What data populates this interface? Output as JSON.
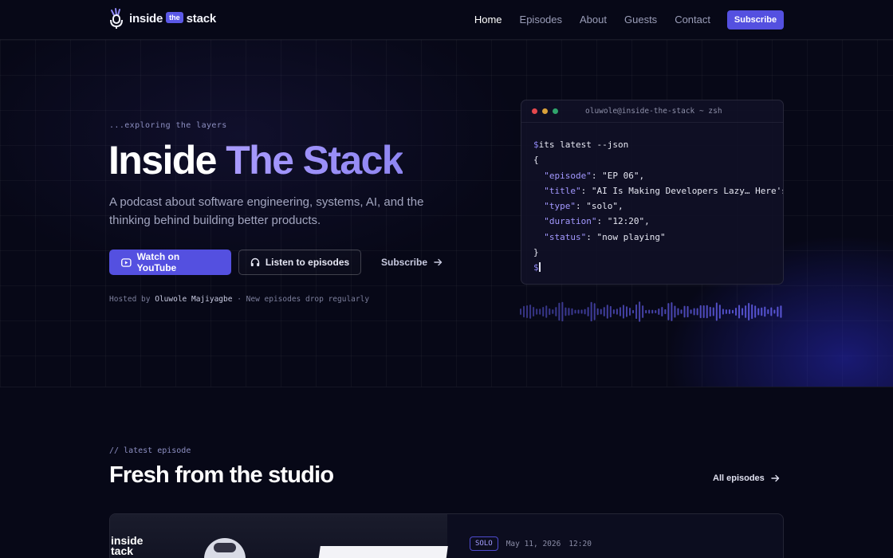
{
  "brand": {
    "word1": "inside",
    "the": "the",
    "word2": "stack"
  },
  "nav": {
    "items": [
      "Home",
      "Episodes",
      "About",
      "Guests",
      "Contact"
    ],
    "subscribe_label": "Subscribe"
  },
  "hero": {
    "eyebrow": "...exploring the layers",
    "title_plain": "Inside",
    "title_accent": "The Stack",
    "description": "A podcast about software engineering, systems, AI, and the thinking behind building better products.",
    "cta_primary": "Watch on YouTube",
    "cta_secondary": "Listen to episodes",
    "cta_link": "Subscribe",
    "hosted_prefix": "Hosted by",
    "host_name": "Oluwole Majiyagbe",
    "hosted_suffix": "· New episodes drop regularly"
  },
  "terminal": {
    "title": "oluwole@inside-the-stack ~ zsh",
    "dot_colors": [
      "#e5484d",
      "#d9a13a",
      "#30a46c"
    ],
    "command": "its latest --json",
    "prompt": "$",
    "json": [
      {
        "key": "\"episode\"",
        "value": "\"EP 06\","
      },
      {
        "key": "\"title\"",
        "value": "\"AI Is Making Developers Lazy… Here's"
      },
      {
        "key": "\"type\"",
        "value": "\"solo\","
      },
      {
        "key": "\"duration\"",
        "value": "\"12:20\","
      },
      {
        "key": "\"status\"",
        "value": "\"now playing\""
      }
    ]
  },
  "latest": {
    "eyebrow": "// latest episode",
    "title": "Fresh from the studio",
    "all_link": "All episodes",
    "card": {
      "thumb_label_1": "inside",
      "thumb_label_2": "tack",
      "tag": "SOLO",
      "date": "May 11, 2026",
      "duration": "12:20"
    }
  },
  "colors": {
    "accent": "#5450e0",
    "background": "#070817",
    "accent_text": "#a398ff"
  },
  "icons": [
    "microphone-logo-icon",
    "youtube-play-icon",
    "headphones-icon",
    "arrow-right-icon"
  ]
}
